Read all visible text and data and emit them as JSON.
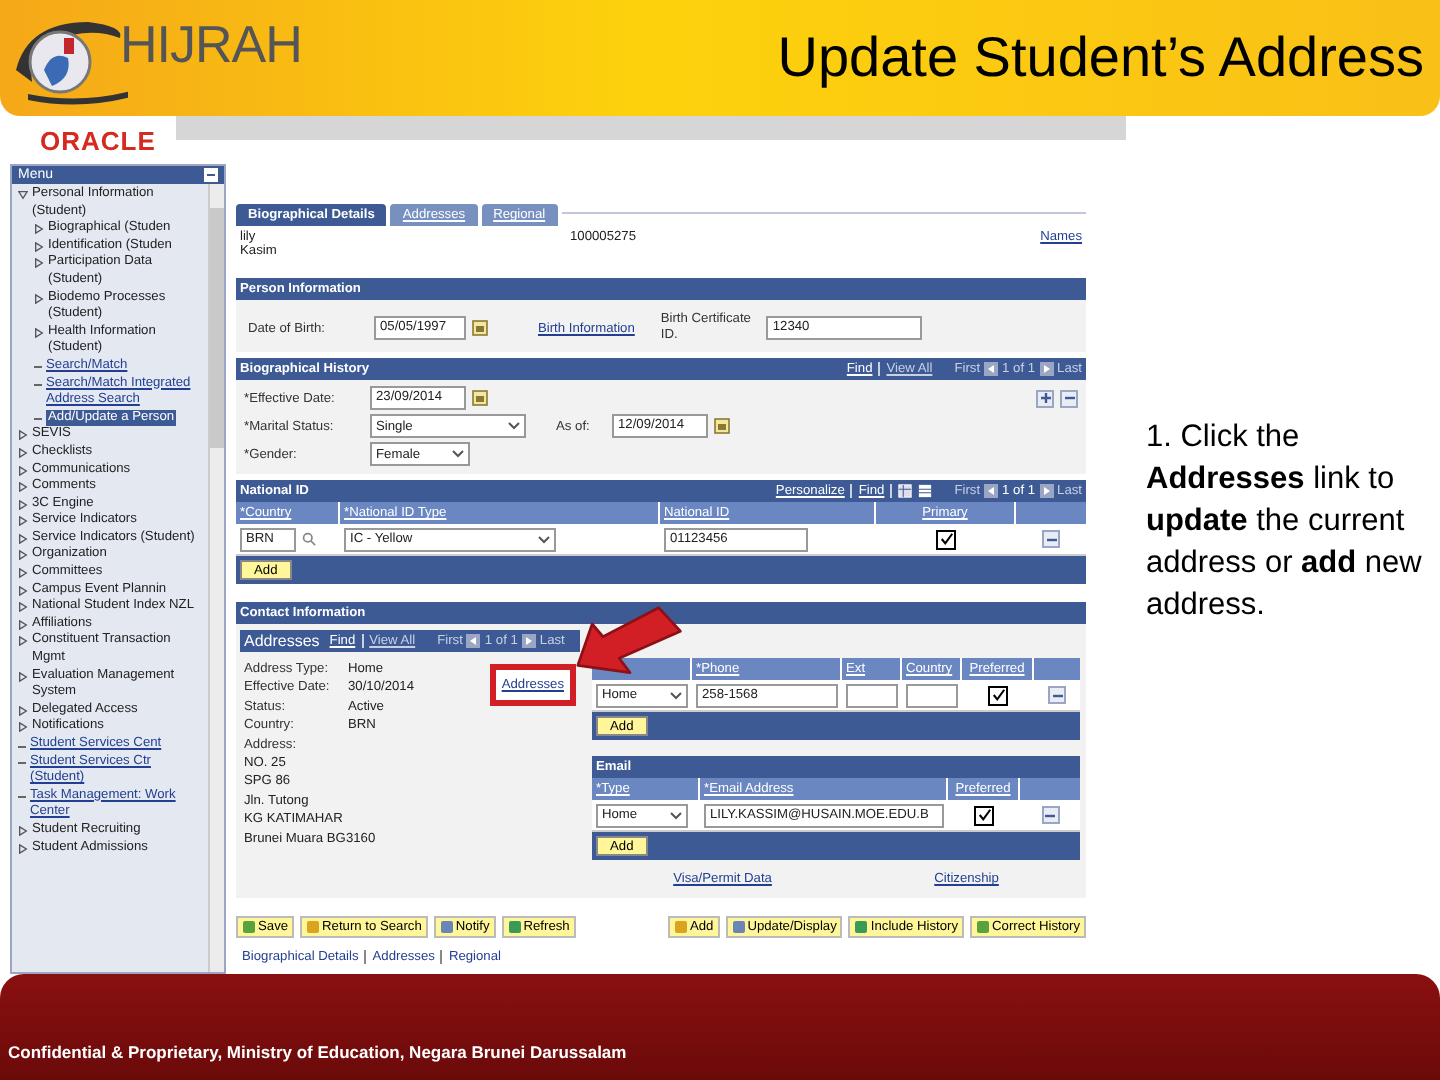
{
  "slide": {
    "logo": "HIJRAH",
    "title": "Update Student’s Address",
    "footer": "Confidential & Proprietary, Ministry of Education, Negara Brunei Darussalam"
  },
  "app": {
    "brand": "ORACLE"
  },
  "menu": {
    "title": "Menu",
    "items": [
      {
        "label": "Personal Information (Student)",
        "kind": "folder",
        "expanded": true,
        "selected": false,
        "children": [
          {
            "label": "Biographical (Studen",
            "kind": "folder",
            "expanded": false,
            "selected": false
          },
          {
            "label": "Identification (Studen",
            "kind": "folder",
            "expanded": false,
            "selected": false
          },
          {
            "label": "Participation Data (Student)",
            "kind": "folder",
            "expanded": false,
            "selected": false
          },
          {
            "label": "Biodemo Processes (Student)",
            "kind": "folder",
            "expanded": false,
            "selected": false
          },
          {
            "label": "Health Information (Student)",
            "kind": "folder",
            "expanded": false,
            "selected": false
          },
          {
            "label": "Search/Match",
            "kind": "link",
            "selected": false
          },
          {
            "label": "Search/Match Integrated Address Search",
            "kind": "link",
            "selected": false
          },
          {
            "label": "Add/Update a Person",
            "kind": "link",
            "selected": true
          }
        ]
      },
      {
        "label": "SEVIS",
        "kind": "folder",
        "expanded": false,
        "selected": false
      },
      {
        "label": "Checklists",
        "kind": "folder",
        "expanded": false,
        "selected": false
      },
      {
        "label": "Communications",
        "kind": "folder",
        "expanded": false,
        "selected": false
      },
      {
        "label": "Comments",
        "kind": "folder",
        "expanded": false,
        "selected": false
      },
      {
        "label": "3C Engine",
        "kind": "folder",
        "expanded": false,
        "selected": false
      },
      {
        "label": "Service Indicators",
        "kind": "folder",
        "expanded": false,
        "selected": false
      },
      {
        "label": "Service Indicators (Student)",
        "kind": "folder",
        "expanded": false,
        "selected": false
      },
      {
        "label": "Organization",
        "kind": "folder",
        "expanded": false,
        "selected": false
      },
      {
        "label": "Committees",
        "kind": "folder",
        "expanded": false,
        "selected": false
      },
      {
        "label": "Campus Event Plannin",
        "kind": "folder",
        "expanded": false,
        "selected": false
      },
      {
        "label": "National Student Index NZL",
        "kind": "folder",
        "expanded": false,
        "selected": false
      },
      {
        "label": "Affiliations",
        "kind": "folder",
        "expanded": false,
        "selected": false
      },
      {
        "label": "Constituent Transaction Mgmt",
        "kind": "folder",
        "expanded": false,
        "selected": false
      },
      {
        "label": "Evaluation Management System",
        "kind": "folder",
        "expanded": false,
        "selected": false
      },
      {
        "label": "Delegated Access",
        "kind": "folder",
        "expanded": false,
        "selected": false
      },
      {
        "label": "Notifications",
        "kind": "folder",
        "expanded": false,
        "selected": false
      },
      {
        "label": "Student Services Cent",
        "kind": "link",
        "selected": false
      },
      {
        "label": "Student Services Ctr (Student)",
        "kind": "link",
        "selected": false
      },
      {
        "label": "Task Management: Work Center",
        "kind": "link",
        "selected": false
      },
      {
        "label": "Student Recruiting",
        "kind": "folder",
        "expanded": false,
        "selected": false
      },
      {
        "label": "Student Admissions",
        "kind": "folder",
        "expanded": false,
        "selected": false
      }
    ]
  },
  "tabs": [
    {
      "label": "Biographical Details",
      "selected": true
    },
    {
      "label": "Addresses",
      "selected": false
    },
    {
      "label": "Regional",
      "selected": false
    }
  ],
  "person": {
    "name_lines": [
      "lily",
      "Kasim"
    ],
    "id": "100005275",
    "names_link": "Names"
  },
  "person_information": {
    "title": "Person Information",
    "dob_label": "Date of Birth:",
    "dob": "05/05/1997",
    "birth_link": "Birth Information",
    "cert_label": "Birth Certificate ID.",
    "cert": "12340"
  },
  "biographical_history": {
    "title": "Biographical History",
    "find": "Find",
    "view_all": "View All",
    "nav": {
      "first": "First",
      "count": "1 of 1",
      "last": "Last"
    },
    "effective_label": "*Effective Date:",
    "effective": "23/09/2014",
    "marital_label": "*Marital Status:",
    "marital": "Single",
    "asof_label": "As of:",
    "asof": "12/09/2014",
    "gender_label": "*Gender:",
    "gender": "Female"
  },
  "national_id": {
    "title": "National ID",
    "personalize": "Personalize",
    "find": "Find",
    "nav": {
      "first": "First",
      "count": "1 of 1",
      "last": "Last"
    },
    "columns": [
      "*Country",
      "*National ID Type",
      "National ID",
      "Primary"
    ],
    "rows": [
      {
        "country": "BRN",
        "type": "IC - Yellow",
        "id": "01123456",
        "primary": true
      }
    ],
    "add": "Add"
  },
  "contact": {
    "title": "Contact Information",
    "addresses": {
      "title": "Addresses",
      "find": "Find",
      "view_all": "View All",
      "nav": {
        "first": "First",
        "count": "1 of 1",
        "last": "Last"
      },
      "details": [
        {
          "label": "Address Type:",
          "value": "Home"
        },
        {
          "label": "Effective Date:",
          "value": "30/10/2014"
        },
        {
          "label": "Status:",
          "value": "Active"
        },
        {
          "label": "Country:",
          "value": "BRN"
        }
      ],
      "address_label": "Address:",
      "address_lines": [
        "NO. 25",
        "SPG 86",
        "Jln. Tutong",
        "KG KATIMAHAR",
        "Brunei  Muara BG3160"
      ],
      "link": "Addresses"
    },
    "phone": {
      "columns": [
        "*Phone",
        "Ext",
        "Country",
        "Preferred"
      ],
      "rows": [
        {
          "type": "Home",
          "phone": "258-1568",
          "preferred": true
        }
      ],
      "add": "Add"
    },
    "email": {
      "title": "Email",
      "columns": [
        "*Type",
        "*Email Address",
        "Preferred"
      ],
      "rows": [
        {
          "type": "Home",
          "email": "LILY.KASSIM@HUSAIN.MOE.EDU.B",
          "preferred": true
        }
      ],
      "add": "Add"
    },
    "links": [
      "Visa/Permit Data",
      "Citizenship"
    ]
  },
  "toolbar": {
    "left": [
      "Save",
      "Return to Search",
      "Notify",
      "Refresh"
    ],
    "right": [
      "Add",
      "Update/Display",
      "Include History",
      "Correct History"
    ]
  },
  "bottom_links": [
    "Biographical Details",
    "Addresses",
    "Regional"
  ],
  "callout": "1. Click the **Addresses** link to **update** the current address or **add** new address."
}
